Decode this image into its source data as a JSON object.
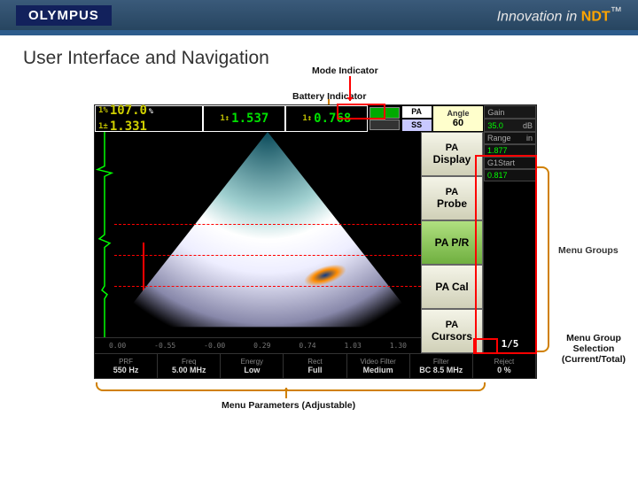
{
  "brand": {
    "logo": "OLYMPUS",
    "tagline_pre": "Innovation in ",
    "tagline_ndt": "NDT"
  },
  "title": "User Interface and Navigation",
  "annotations": {
    "mode": "Mode Indicator",
    "battery": "Battery Indicator",
    "menu_groups": "Menu Groups",
    "menu_group_sel": "Menu Group Selection (Current/Total)",
    "menu_params": "Menu Parameters (Adjustable)"
  },
  "measurements": {
    "a1_icon": "1%",
    "a1_val": "107.0",
    "a1_unit": "%",
    "a2_icon": "1±",
    "a2_val": "1.331",
    "b_icon": "1↕",
    "b_val": "1.537",
    "c_icon": "1↕",
    "c_val": "0.768"
  },
  "mode": {
    "pa": "PA",
    "ss": "SS"
  },
  "current_menu": {
    "label": "Angle",
    "value": "60"
  },
  "right_top": [
    {
      "label": "Gain",
      "value": "35.0",
      "unit": "dB"
    },
    {
      "label": "Range",
      "value": "1.877",
      "unit": "in"
    },
    {
      "label": "G1Start",
      "value": "0.817",
      "unit": ""
    }
  ],
  "side_menu": [
    {
      "small": "PA",
      "main": "Display"
    },
    {
      "small": "PA",
      "main": "Probe"
    },
    {
      "small": "",
      "main": "PA P/R"
    },
    {
      "small": "",
      "main": "PA Cal"
    },
    {
      "small": "PA",
      "main": "Cursors"
    }
  ],
  "page_indicator": "1/5",
  "axis_ticks": [
    "0.00",
    "-0.55",
    "-0.00",
    "0.29",
    "0.74",
    "1.03",
    "1.30"
  ],
  "bottom_params": [
    {
      "label": "PRF",
      "value": "550",
      "unit": "Hz"
    },
    {
      "label": "Freq",
      "value": "5.00",
      "unit": "MHz"
    },
    {
      "label": "Energy",
      "value": "Low",
      "unit": ""
    },
    {
      "label": "Rect",
      "value": "Full",
      "unit": ""
    },
    {
      "label": "Video Filter",
      "value": "Medium",
      "unit": ""
    },
    {
      "label": "Filter",
      "value": "BC 8.5",
      "unit": "MHz"
    },
    {
      "label": "Reject",
      "value": "0",
      "unit": "%"
    }
  ]
}
